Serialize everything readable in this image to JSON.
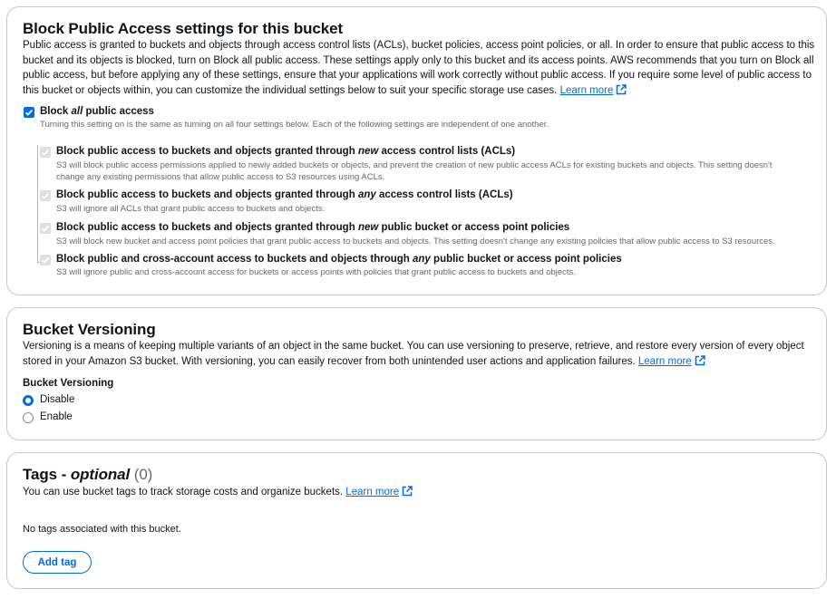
{
  "block_public_access": {
    "title": "Block Public Access settings for this bucket",
    "desc_line1": "Public access is granted to buckets and objects through access control lists (ACLs), bucket policies, access point policies, or all. In order to ensure that public access to this",
    "desc_line2": "bucket and its objects is blocked, turn on Block all public access. These settings apply only to this bucket and its access points. AWS recommends that you turn on Block all",
    "desc_line3": "public access, but before applying any of these settings, ensure that your applications will work correctly without public access. If you require some level of public access to",
    "desc_line4": "this bucket or objects within, you can customize the individual settings below to suit your specific storage use cases.",
    "learn_more": "Learn more",
    "block_all": {
      "label_pre": "Block ",
      "label_em": "all",
      "label_post": " public access",
      "desc": "Turning this setting on is the same as turning on all four settings below. Each of the following settings are independent of one another.",
      "checked": true
    },
    "settings": [
      {
        "title_pre": "Block public access to buckets and objects granted through ",
        "title_em": "new",
        "title_post": " access control lists (ACLs)",
        "desc_line1": "S3 will block public access permissions applied to newly added buckets or objects, and prevent the creation of new public access ACLs for existing buckets and objects. This setting doesn't",
        "desc_line2": "change any existing permissions that allow public access to S3 resources using ACLs."
      },
      {
        "title_pre": "Block public access to buckets and objects granted through ",
        "title_em": "any",
        "title_post": " access control lists (ACLs)",
        "desc_line1": "S3 will ignore all ACLs that grant public access to buckets and objects.",
        "desc_line2": ""
      },
      {
        "title_pre": "Block public access to buckets and objects granted through ",
        "title_em": "new",
        "title_post": " public bucket or access point policies",
        "desc_line1": "S3 will block new bucket and access point policies that grant public access to buckets and objects. This setting doesn't change any existing policies that allow public access to S3 resources.",
        "desc_line2": ""
      },
      {
        "title_pre": "Block public and cross-account access to buckets and objects through ",
        "title_em": "any",
        "title_post": " public bucket or access point policies",
        "desc_line1": "S3 will ignore public and cross-account access for buckets or access points with policies that grant public access to buckets and objects.",
        "desc_line2": ""
      }
    ]
  },
  "versioning": {
    "title": "Bucket Versioning",
    "desc_line1": "Versioning is a means of keeping multiple variants of an object in the same bucket. You can use versioning to preserve, retrieve, and restore every version of every object",
    "desc_line2": "stored in your Amazon S3 bucket. With versioning, you can easily recover from both unintended user actions and application failures.",
    "learn_more": "Learn more",
    "field_label": "Bucket Versioning",
    "options": [
      "Disable",
      "Enable"
    ],
    "selected": "Disable"
  },
  "tags": {
    "title_pre": "Tags - ",
    "title_em": "optional",
    "count": "(0)",
    "desc": "You can use bucket tags to track storage costs and organize buckets.",
    "learn_more": "Learn more",
    "empty": "No tags associated with this bucket.",
    "add_button": "Add tag"
  },
  "colors": {
    "accent": "#006ce0",
    "text": "#0f141a",
    "muted": "#656871",
    "border": "#c6c6cd"
  }
}
